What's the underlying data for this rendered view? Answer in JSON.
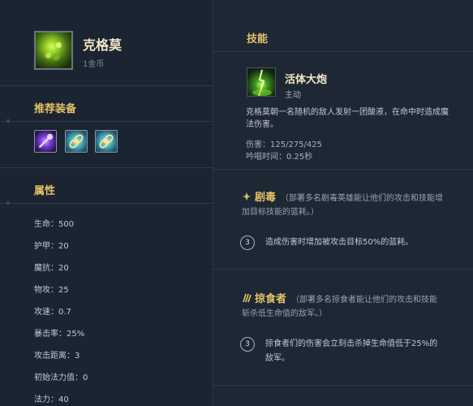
{
  "hero": {
    "name": "克格莫",
    "cost": "1金币"
  },
  "sections": {
    "items_title": "推荐装备",
    "attributes_title": "属性",
    "skill_title": "技能"
  },
  "items": [
    {
      "name": "item-arcane-staff"
    },
    {
      "name": "item-chain-a"
    },
    {
      "name": "item-chain-b"
    }
  ],
  "stats": [
    "生命：500",
    "护甲：20",
    "魔抗：20",
    "物攻：25",
    "攻速：0.7",
    "暴击率：25%",
    "攻击距离：3",
    "初始法力值：0",
    "法力：40"
  ],
  "skill": {
    "name": "活体大炮",
    "type": "主动",
    "description": "克格莫朝一名随机的敌人发射一团酸液，在命中时造成魔法伤害。",
    "damage": "伤害：125/275/425",
    "cast_time": "吟唱时间：0.25秒"
  },
  "traits": [
    {
      "name": "剧毒",
      "desc": "（部署多名剧毒英雄能让他们的攻击和技能增加目标技能的蓝耗。）",
      "tier": "3",
      "tier_text": "造成伤害时增加被攻击目标50%的蓝耗。"
    },
    {
      "name": "掠食者",
      "desc": "（部署多名掠食者能让他们的攻击和技能斩杀低生命值的敌军。）",
      "tier": "3",
      "tier_text": "掠食者们的伤害会立刻击杀掉生命值低于25%的敌军。"
    }
  ]
}
